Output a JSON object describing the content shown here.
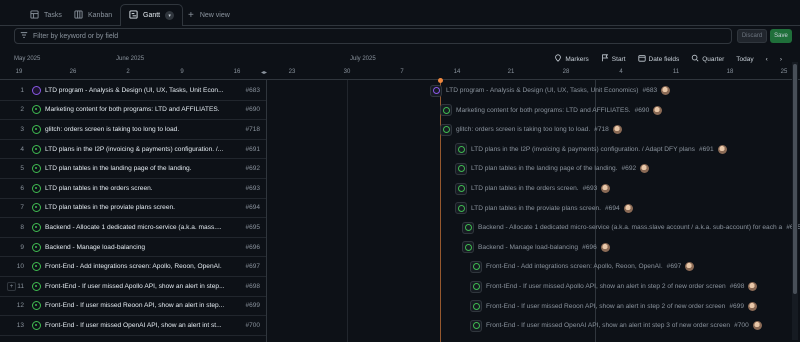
{
  "tabs": [
    {
      "label": "Tasks",
      "icon": "table-icon"
    },
    {
      "label": "Kanban",
      "icon": "board-icon"
    },
    {
      "label": "Gantt",
      "icon": "gantt-icon",
      "active": true
    }
  ],
  "new_view_label": "New view",
  "filter": {
    "placeholder": "Filter by keyword or by field"
  },
  "actions": {
    "discard_label": "Discard",
    "save_label": "Save"
  },
  "timeline": {
    "months": [
      "May 2025",
      "June 2025",
      "July 2025"
    ],
    "days": [
      "19",
      "26",
      "2",
      "9",
      "16",
      "23",
      "30",
      "7",
      "14",
      "21",
      "28",
      "4",
      "11",
      "18",
      "25"
    ],
    "tools": {
      "markers": "Markers",
      "start": "Start",
      "date_fields": "Date fields",
      "zoom": "Quarter",
      "today": "Today"
    }
  },
  "rows": [
    {
      "num": "1",
      "title": "LTD program - Analysis & Design (UI, UX, Tasks, Unit Econ...",
      "bar_title": "LTD program - Analysis & Design (UI, UX, Tasks, Unit Economics)",
      "issue": "#683",
      "status": "done"
    },
    {
      "num": "2",
      "title": "Marketing content for both programs: LTD and AFFILIATES.",
      "bar_title": "Marketing content for both programs: LTD and AFFILIATES.",
      "issue": "#690",
      "status": "open"
    },
    {
      "num": "3",
      "title": "glitch: orders screen is taking too long to load.",
      "bar_title": "glitch: orders screen is taking too long to load.",
      "issue": "#718",
      "status": "open"
    },
    {
      "num": "4",
      "title": "LTD plans in the I2P (invoicing & payments) configuration. /...",
      "bar_title": "LTD plans in the I2P (invoicing & payments) configuration. / Adapt DFY plans",
      "issue": "#691",
      "status": "open"
    },
    {
      "num": "5",
      "title": "LTD plan tables in the landing page of the landing.",
      "bar_title": "LTD plan tables in the landing page of the landing.",
      "issue": "#692",
      "status": "open"
    },
    {
      "num": "6",
      "title": "LTD plan tables in the orders screen.",
      "bar_title": "LTD plan tables in the orders screen.",
      "issue": "#693",
      "status": "open"
    },
    {
      "num": "7",
      "title": "LTD plan tables in the proviate plans screen.",
      "bar_title": "LTD plan tables in the proviate plans screen.",
      "issue": "#694",
      "status": "open"
    },
    {
      "num": "8",
      "title": "Backend - Allocate 1 dedicated micro-service (a.k.a. mass....",
      "bar_title": "Backend - Allocate 1 dedicated micro-service (a.k.a. mass.slave account / a.k.a. sub-account) for each a",
      "issue": "#695",
      "status": "open"
    },
    {
      "num": "9",
      "title": "Backend - Manage load-balancing",
      "bar_title": "Backend - Manage load-balancing",
      "issue": "#696",
      "status": "open"
    },
    {
      "num": "10",
      "title": "Front-End - Add integrations screen: Apollo, Reoon, OpenAI.",
      "bar_title": "Front-End - Add integrations screen: Apollo, Reoon, OpenAI.",
      "issue": "#697",
      "status": "open"
    },
    {
      "num": "11",
      "title": "Front-tEnd - If user missed Apollo API, show an alert in step...",
      "bar_title": "Front-tEnd - If user missed Apollo API, show an alert in step 2 of new order screen",
      "issue": "#698",
      "status": "open"
    },
    {
      "num": "12",
      "title": "Front-End - If user missed Reoon API, show an alert in step...",
      "bar_title": "Front-End - If user missed Reoon API, show an alert in step 2 of new order screen",
      "issue": "#699",
      "status": "open"
    },
    {
      "num": "13",
      "title": "Front-End - If user missed OpenAI API, show an alert int st...",
      "bar_title": "Front-End - If user missed OpenAI API, show an alert int step 3 of new order screen",
      "issue": "#700",
      "status": "open"
    }
  ],
  "colors": {
    "open": "#3fb950",
    "done": "#8957e5",
    "today": "#f0883e",
    "save": "#1f6f3a"
  }
}
